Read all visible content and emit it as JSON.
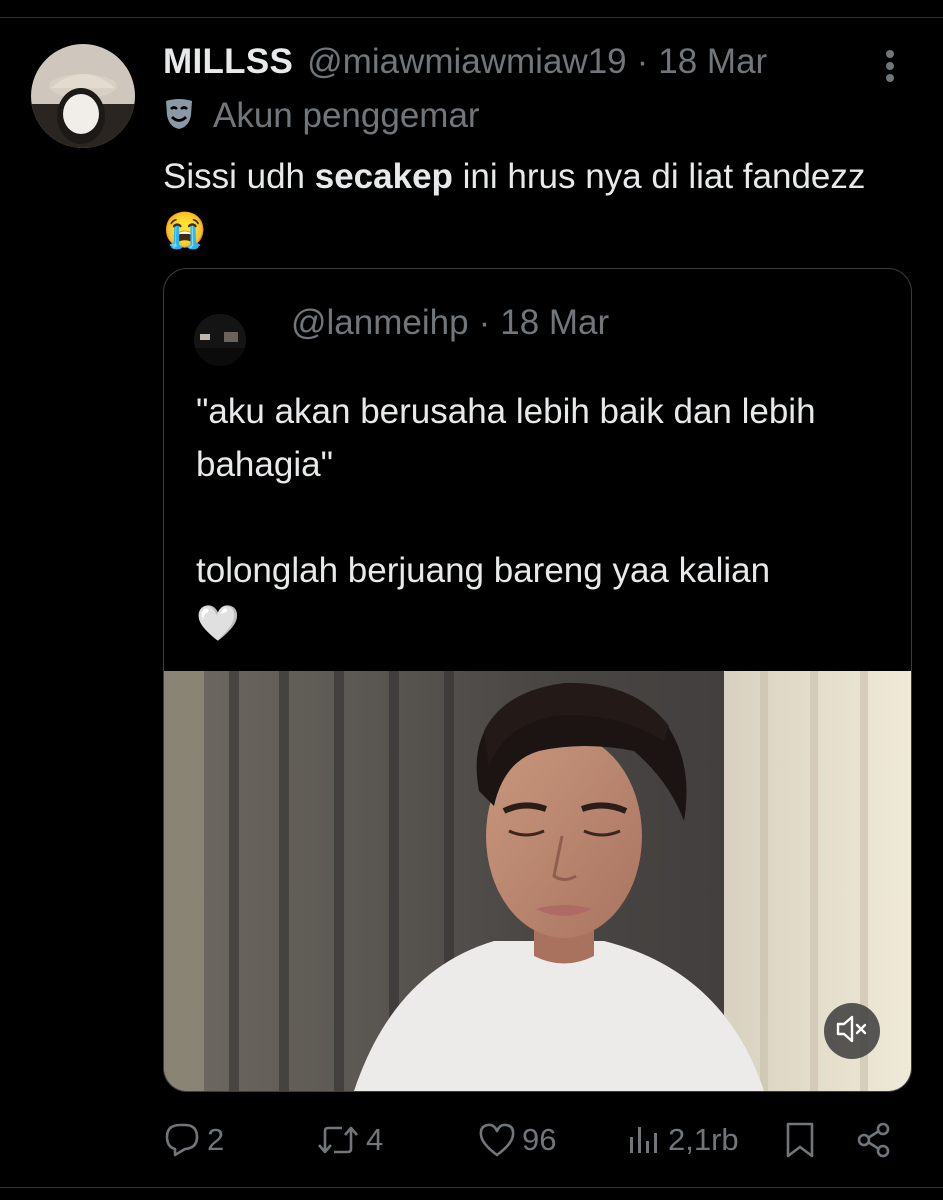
{
  "tweet": {
    "display_name": "MILLSS",
    "handle": "@miawmiawmiaw19",
    "separator": "·",
    "date": "18 Mar",
    "account_label": "Akun penggemar",
    "text_part1": "Sissi udh ",
    "text_bold": "secakep",
    "text_part2": " ini hrus nya di liat fandezz ",
    "text_emoji": "😭"
  },
  "quoted": {
    "handle": "@lanmeihp",
    "separator": "·",
    "date": "18 Mar",
    "line1": "\"aku akan berusaha lebih baik dan lebih bahagia\"",
    "line2": "tolonglah berjuang bareng yaa kalian",
    "line2_emoji": "🤍",
    "media_controls": {
      "mute_icon": "speaker-muted-icon"
    }
  },
  "actions": {
    "replies": "2",
    "reposts": "4",
    "likes": "96",
    "views": "2,1rb"
  },
  "icons": [
    "more-vertical-icon",
    "theater-mask-icon",
    "reply-icon",
    "repost-icon",
    "like-icon",
    "views-icon",
    "bookmark-icon",
    "share-icon"
  ],
  "colors": {
    "background": "#000000",
    "text": "#e7e9ea",
    "muted": "#71767b"
  }
}
